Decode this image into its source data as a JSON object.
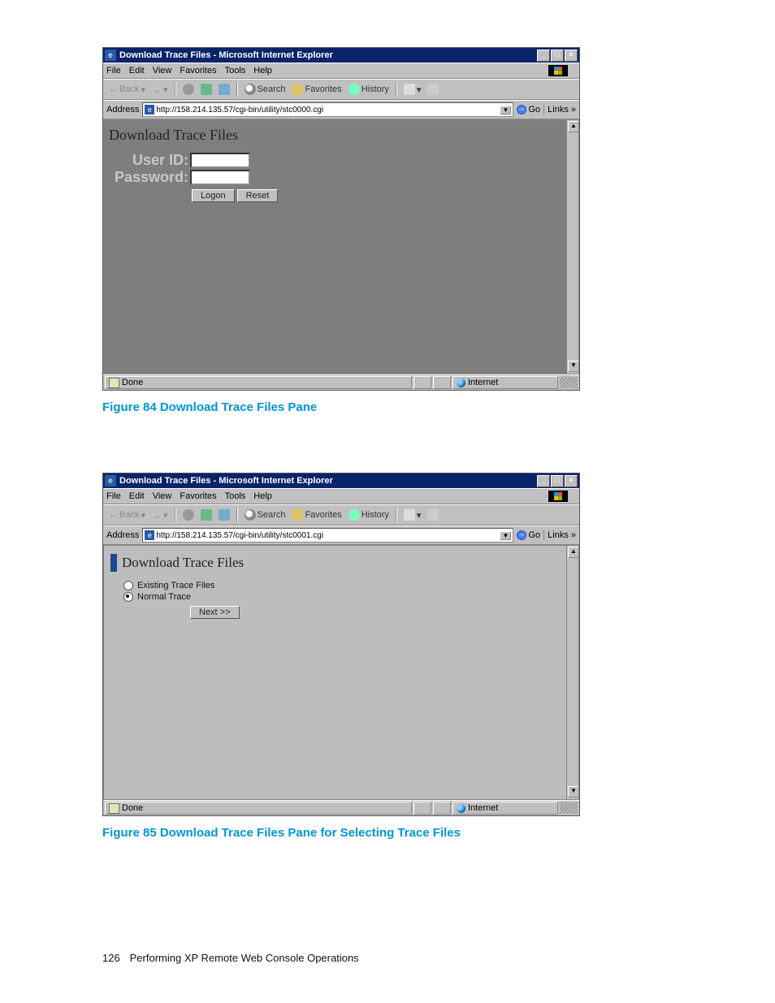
{
  "window": {
    "title": "Download Trace Files  - Microsoft Internet Explorer",
    "menus": [
      "File",
      "Edit",
      "View",
      "Favorites",
      "Tools",
      "Help"
    ],
    "toolbar": {
      "back": "Back",
      "search": "Search",
      "favorites": "Favorites",
      "history": "History"
    },
    "address_label": "Address",
    "go_label": "Go",
    "links_label": "Links »"
  },
  "status": {
    "done": "Done",
    "zone": "Internet"
  },
  "pane1": {
    "url": "http://158.214.135.57/cgi-bin/utility/stc0000.cgi",
    "heading": "Download Trace Files",
    "user_id_label": "User ID:",
    "password_label": "Password:",
    "logon_btn": "Logon",
    "reset_btn": "Reset"
  },
  "pane2": {
    "url": "http://158.214.135.57/cgi-bin/utility/stc0001.cgi",
    "heading": "Download Trace Files",
    "opt_existing": "Existing Trace Files",
    "opt_normal": "Normal Trace",
    "selected": "normal",
    "next_btn": "Next >>"
  },
  "captions": {
    "fig84": "Figure 84 Download Trace Files Pane",
    "fig85": "Figure 85 Download Trace Files Pane for Selecting Trace Files"
  },
  "footer": {
    "page_no": "126",
    "section": "Performing XP Remote Web Console Operations"
  }
}
